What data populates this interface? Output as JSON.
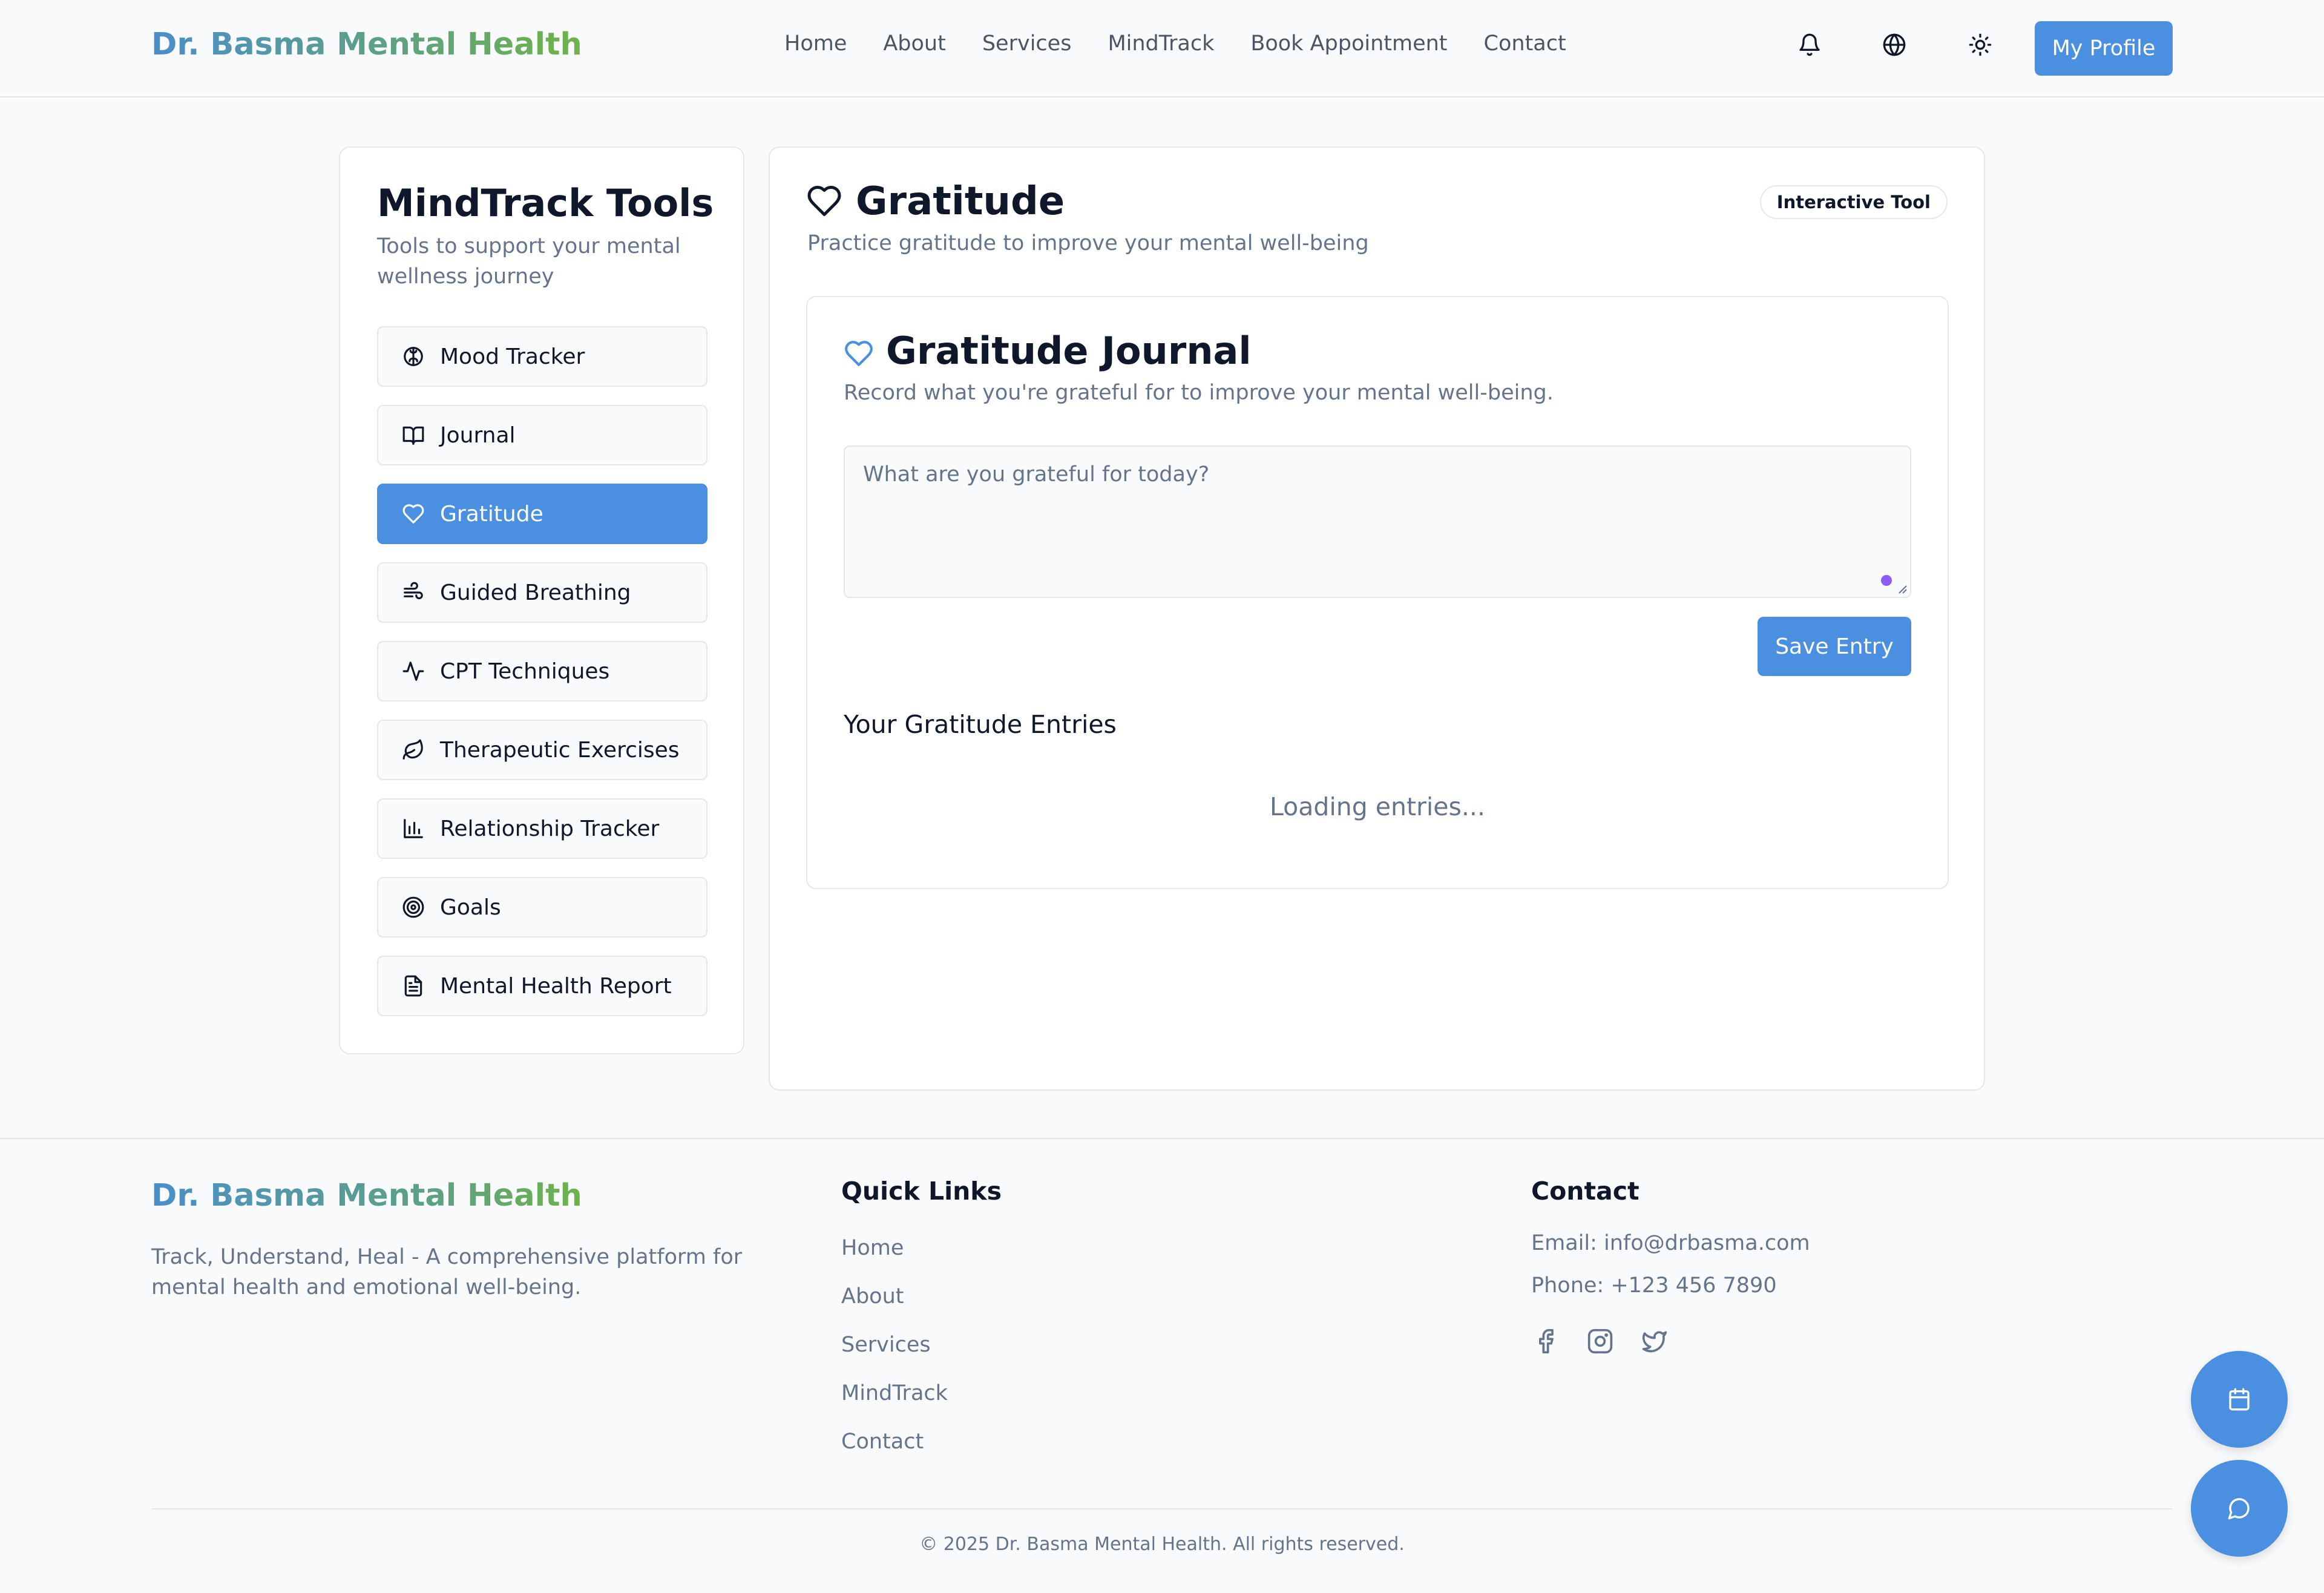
{
  "header": {
    "brand": "Dr. Basma Mental Health",
    "nav": [
      "Home",
      "About",
      "Services",
      "MindTrack",
      "Book Appointment",
      "Contact"
    ],
    "profile_label": "My Profile",
    "icons": [
      "bell-icon",
      "globe-icon",
      "sun-icon"
    ]
  },
  "sidebar": {
    "title": "MindTrack Tools",
    "subtitle": "Tools to support your mental wellness journey",
    "items": [
      {
        "label": "Mood Tracker",
        "icon": "brain-icon"
      },
      {
        "label": "Journal",
        "icon": "book-icon"
      },
      {
        "label": "Gratitude",
        "icon": "heart-icon",
        "active": true
      },
      {
        "label": "Guided Breathing",
        "icon": "wind-icon"
      },
      {
        "label": "CPT Techniques",
        "icon": "activity-icon"
      },
      {
        "label": "Therapeutic Exercises",
        "icon": "leaf-icon"
      },
      {
        "label": "Relationship Tracker",
        "icon": "bar-chart-icon"
      },
      {
        "label": "Goals",
        "icon": "target-icon"
      },
      {
        "label": "Mental Health Report",
        "icon": "file-text-icon"
      }
    ]
  },
  "main": {
    "title": "Gratitude",
    "subtitle": "Practice gratitude to improve your mental well-being",
    "badge": "Interactive Tool",
    "journal": {
      "title": "Gratitude Journal",
      "subtitle": "Record what you're grateful for to improve your mental well-being.",
      "placeholder": "What are you grateful for today?",
      "save_label": "Save Entry",
      "entries_title": "Your Gratitude Entries",
      "loading_text": "Loading entries..."
    }
  },
  "footer": {
    "brand": "Dr. Basma Mental Health",
    "description": "Track, Understand, Heal - A comprehensive platform for mental health and emotional well-being.",
    "quick_links_title": "Quick Links",
    "quick_links": [
      "Home",
      "About",
      "Services",
      "MindTrack",
      "Contact"
    ],
    "contact_title": "Contact",
    "email": "Email: info@drbasma.com",
    "phone": "Phone: +123 456 7890",
    "social": [
      "facebook-icon",
      "instagram-icon",
      "twitter-icon"
    ],
    "copyright": "© 2025 Dr. Basma Mental Health. All rights reserved."
  },
  "colors": {
    "accent": "#4a8fe0",
    "text_muted": "#64748b",
    "border": "#e5e7eb",
    "brand_gradient_start": "#4a8fc9",
    "brand_gradient_end": "#6fb24a"
  }
}
